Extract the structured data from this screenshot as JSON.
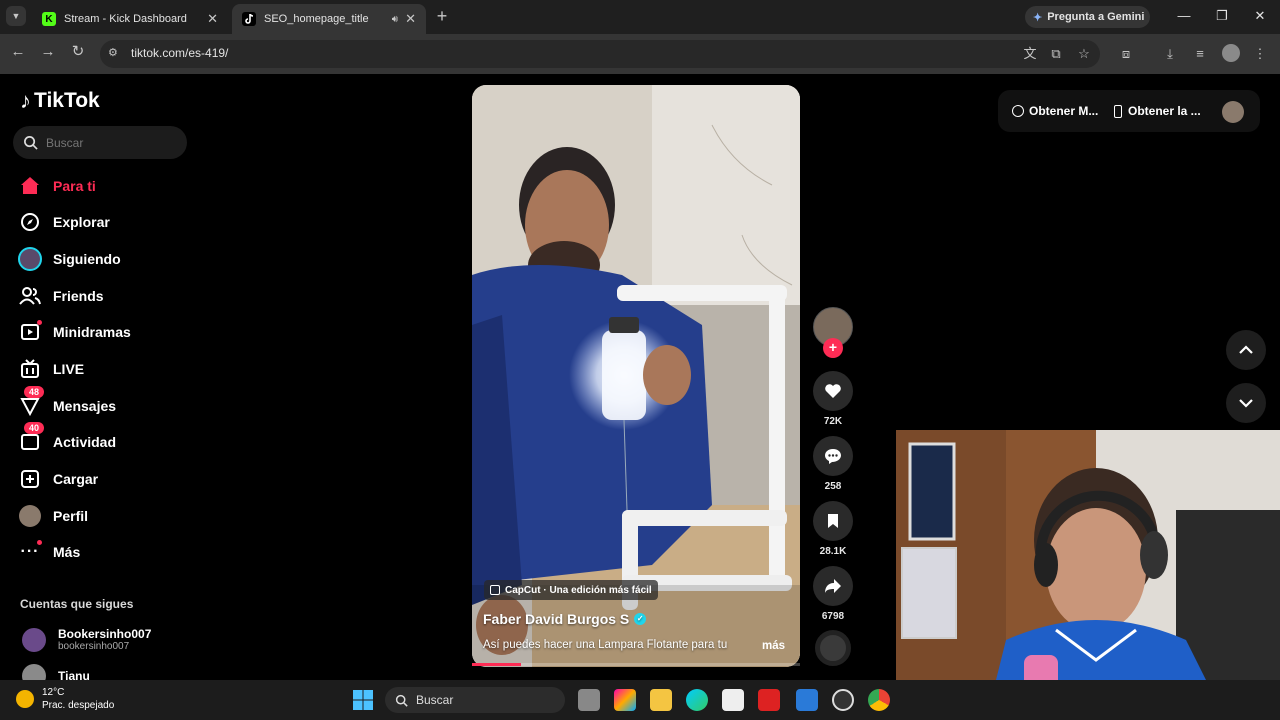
{
  "browser": {
    "tabs": [
      {
        "title": "Stream - Kick Dashboard",
        "favicon": "K"
      },
      {
        "title": "SEO_homepage_title",
        "favicon": "tiktok"
      }
    ],
    "gemini_label": "Pregunta a Gemini",
    "url": "tiktok.com/es-419/"
  },
  "tiktok": {
    "logo": "TikTok",
    "search_placeholder": "Buscar",
    "nav": [
      {
        "label": "Para ti",
        "icon": "home-icon",
        "active": true
      },
      {
        "label": "Explorar",
        "icon": "compass-icon"
      },
      {
        "label": "Siguiendo",
        "icon": "following-avatar-icon"
      },
      {
        "label": "Friends",
        "icon": "friends-icon"
      },
      {
        "label": "Minidramas",
        "icon": "minidramas-icon"
      },
      {
        "label": "LIVE",
        "icon": "live-icon"
      },
      {
        "label": "Mensajes",
        "icon": "messages-icon",
        "badge": "48"
      },
      {
        "label": "Actividad",
        "icon": "activity-icon",
        "badge": "40"
      },
      {
        "label": "Cargar",
        "icon": "upload-icon"
      },
      {
        "label": "Perfil",
        "icon": "profile-avatar-icon"
      },
      {
        "label": "Más",
        "icon": "more-icon"
      }
    ],
    "following_title": "Cuentas que sigues",
    "following": [
      {
        "name": "Bookersinho007",
        "handle": "bookersinho007"
      },
      {
        "name": "Tianu",
        "handle": ""
      }
    ],
    "top_right": {
      "get_app_1": "Obtener M...",
      "get_app_2": "Obtener la ..."
    },
    "video": {
      "capcut_tag": "CapCut · Una edición más fácil",
      "author": "Faber David Burgos S",
      "caption": "Así puedes hacer una Lampara Flotante para tu",
      "more": "más",
      "progress": 0.15,
      "likes": "72K",
      "comments": "258",
      "saves": "28.1K",
      "shares": "6798"
    }
  },
  "taskbar": {
    "temperature": "12°C",
    "weather": "Prac. despejado",
    "search_label": "Buscar"
  },
  "colors": {
    "accent": "#fe2c55",
    "verified": "#20d5ec",
    "chrome_dark": "#1f1f1f",
    "chrome_toolbar": "#353535"
  }
}
